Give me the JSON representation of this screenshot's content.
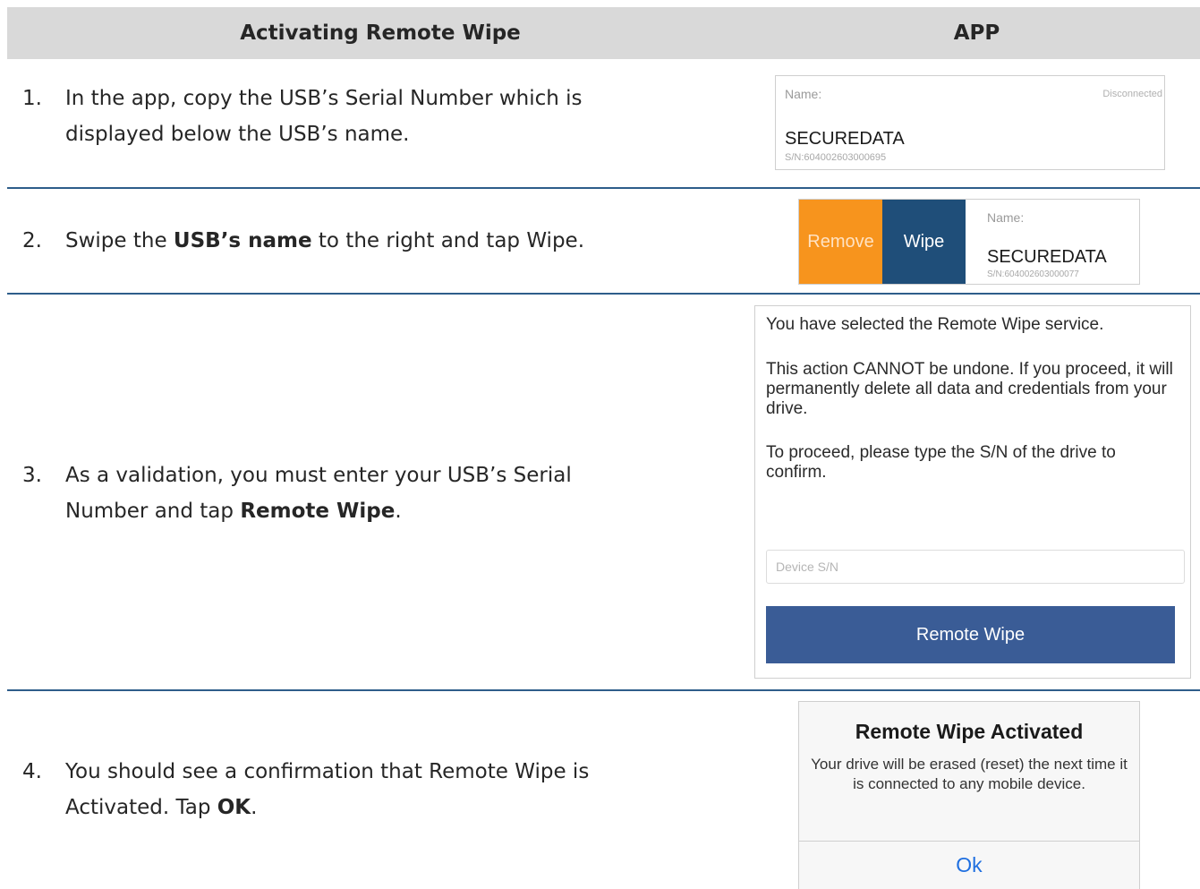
{
  "header": {
    "title": "Activating Remote Wipe",
    "app_column": "APP"
  },
  "steps": [
    {
      "number": "1.",
      "line1": "In the app, copy the USB’s Serial Number which is",
      "line2": "displayed below the USB’s name."
    },
    {
      "number": "2.",
      "pre": "Swipe the ",
      "bold": "USB’s name",
      "post": " to the right and tap Wipe."
    },
    {
      "number": "3.",
      "line1": "As a validation, you must enter your USB’s Serial",
      "line2_pre": "Number and tap ",
      "line2_bold": "Remote Wipe",
      "line2_post": "."
    },
    {
      "number": "4.",
      "line1": "You should see a confirmation that Remote Wipe is",
      "line2_pre": "Activated. Tap ",
      "line2_bold": "OK",
      "line2_post": "."
    }
  ],
  "device_card_1": {
    "name_label": "Name:",
    "status": "Disconnected",
    "device_name": "SECUREDATA",
    "serial": "S/N:604002603000695"
  },
  "device_card_2": {
    "remove_label": "Remove",
    "wipe_label": "Wipe",
    "name_label": "Name:",
    "device_name": "SECUREDATA",
    "serial": "S/N:604002603000077"
  },
  "remote_wipe_dialog": {
    "intro": "You have selected the Remote Wipe service.",
    "warning": "This action CANNOT be undone. If you proceed, it will permanently delete all data and credentials from your drive.",
    "instruction": "To proceed, please type the S/N of the drive to confirm.",
    "input_value": "",
    "input_placeholder": "Device S/N",
    "button_label": "Remote Wipe"
  },
  "confirmation_alert": {
    "title": "Remote Wipe Activated",
    "message": "Your drive will be erased (reset) the next time it is connected to any mobile device.",
    "ok_label": "Ok"
  },
  "colors": {
    "header_bg": "#d9d9d9",
    "rule": "#2e5d8a",
    "remove_orange": "#f7941d",
    "wipe_navy": "#1f4e79",
    "remote_wipe_button": "#3a5c96",
    "ok_blue": "#1f6fe0"
  }
}
